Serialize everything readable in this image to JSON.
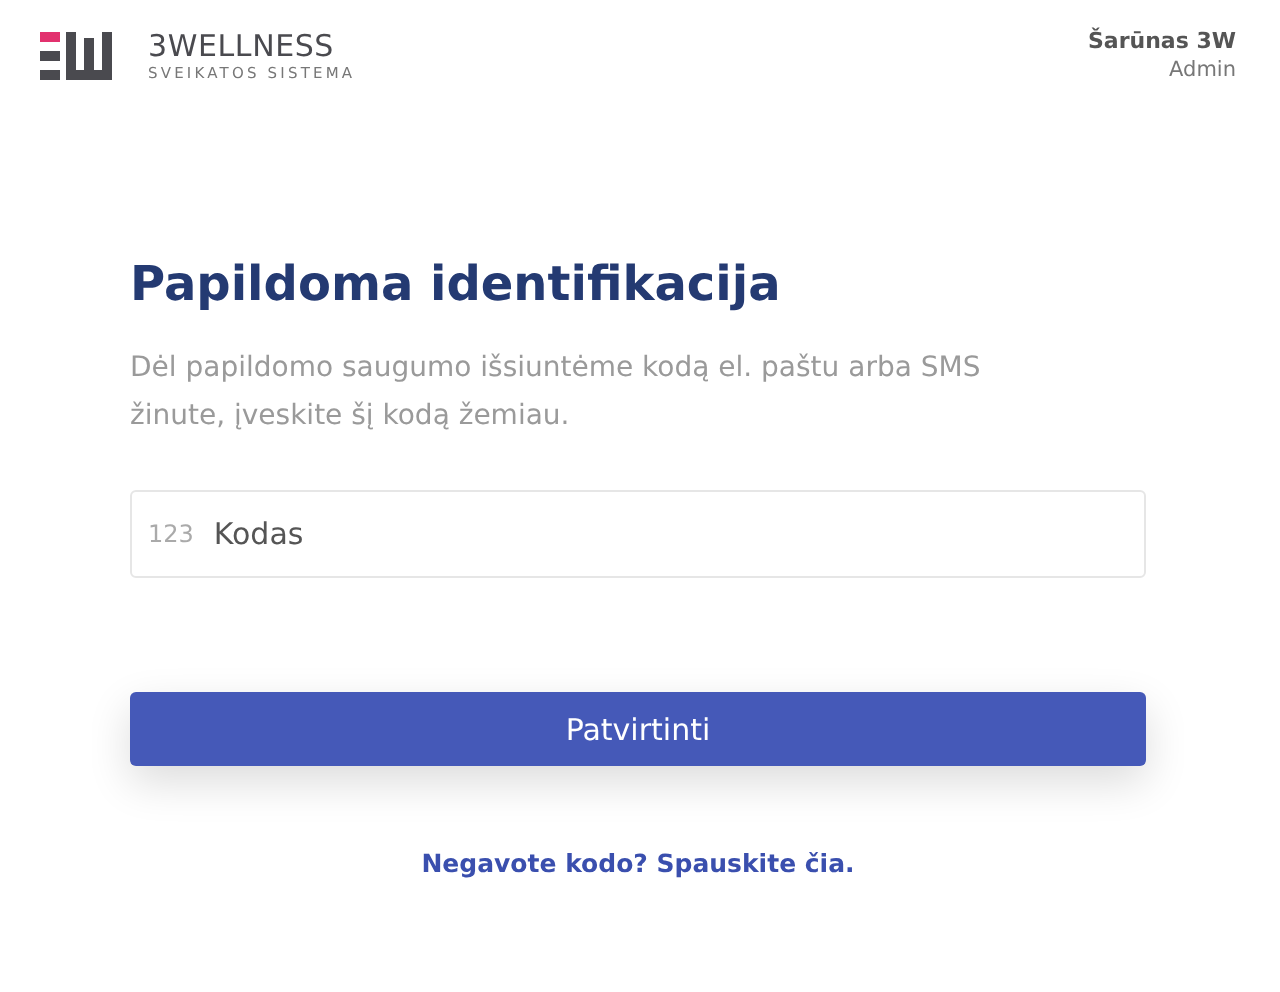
{
  "header": {
    "brand": "3WELLNESS",
    "tagline": "SVEIKATOS SISTEMA",
    "user_name": "Šarūnas 3W",
    "user_role": "Admin"
  },
  "form": {
    "title": "Papildoma identifikacija",
    "description": "Dėl papildomo saugumo išsiuntėme kodą el. paštu arba SMS žinute, įveskite šį kodą žemiau.",
    "code_field": {
      "prefix": "123",
      "placeholder": "Kodas"
    },
    "submit": "Patvirtinti",
    "resend_link": "Negavote kodo? Spauskite čia."
  }
}
